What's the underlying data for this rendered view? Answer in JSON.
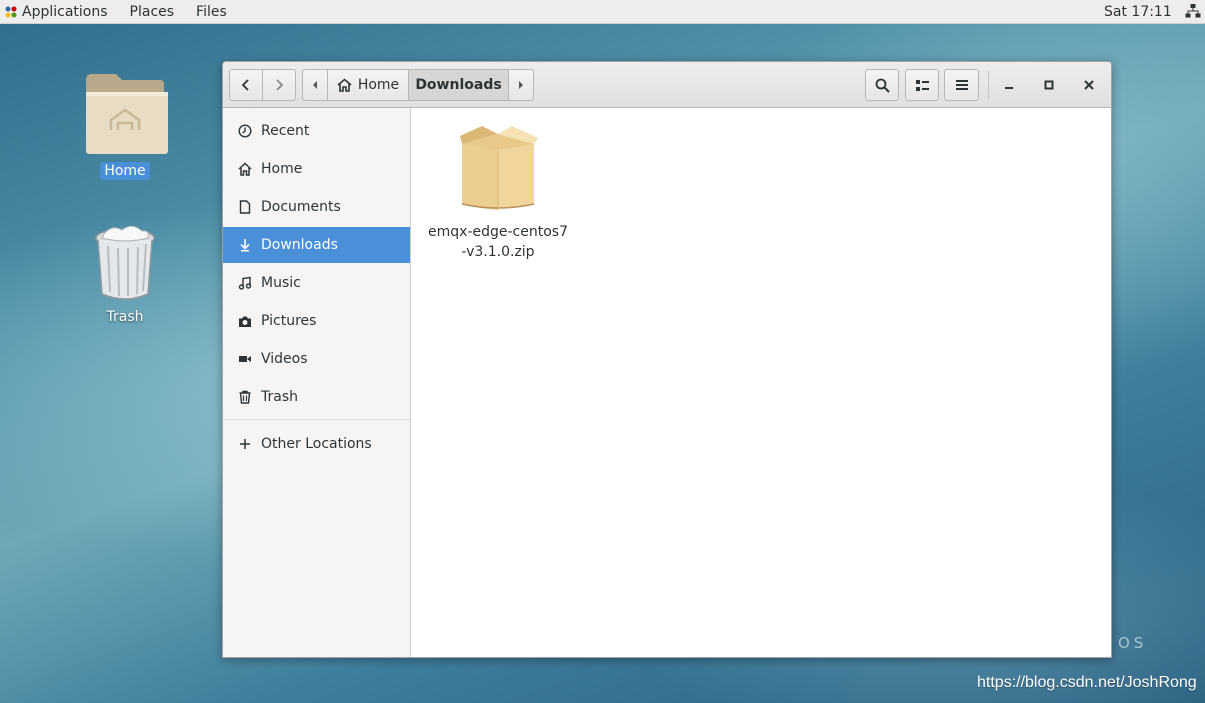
{
  "topbar": {
    "applications": "Applications",
    "places": "Places",
    "files": "Files",
    "clock": "Sat 17:11"
  },
  "desktop": {
    "home_label": "Home",
    "trash_label": "Trash"
  },
  "window": {
    "path": {
      "home": "Home",
      "current": "Downloads"
    },
    "sidebar": {
      "items": [
        {
          "label": "Recent",
          "icon": "clock-icon"
        },
        {
          "label": "Home",
          "icon": "home-icon"
        },
        {
          "label": "Documents",
          "icon": "document-icon"
        },
        {
          "label": "Downloads",
          "icon": "download-icon"
        },
        {
          "label": "Music",
          "icon": "music-icon"
        },
        {
          "label": "Pictures",
          "icon": "camera-icon"
        },
        {
          "label": "Videos",
          "icon": "video-icon"
        },
        {
          "label": "Trash",
          "icon": "trash-icon"
        }
      ],
      "other_locations": "Other Locations"
    },
    "files": [
      {
        "name": "emqx-edge-centos7-v3.1.0.zip",
        "icon": "archive-icon"
      }
    ]
  },
  "watermark": "https://blog.csdn.net/JoshRong",
  "colors": {
    "accent": "#4a90d9",
    "topbar": "#ededed",
    "sidebar": "#f6f5f4"
  }
}
